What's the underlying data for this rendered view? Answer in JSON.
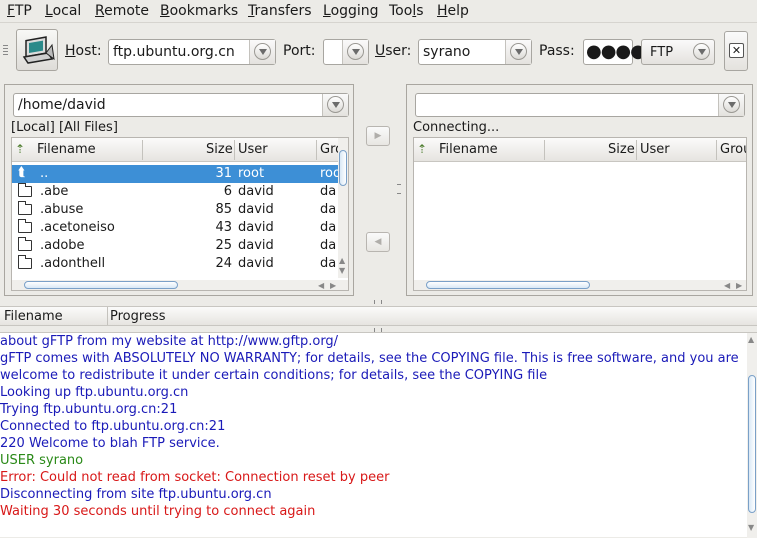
{
  "menu": [
    {
      "pre": "",
      "u": "F",
      "post": "TP"
    },
    {
      "pre": "",
      "u": "L",
      "post": "ocal"
    },
    {
      "pre": "",
      "u": "R",
      "post": "emote"
    },
    {
      "pre": "",
      "u": "B",
      "post": "ookmarks"
    },
    {
      "pre": "",
      "u": "T",
      "post": "ransfers"
    },
    {
      "pre": "",
      "u": "L",
      "post": "ogging"
    },
    {
      "pre": "Too",
      "u": "l",
      "post": "s"
    },
    {
      "pre": "",
      "u": "H",
      "post": "elp"
    }
  ],
  "toolbar": {
    "host_label": "Host:",
    "host_value": "ftp.ubuntu.org.cn",
    "port_label": "Port:",
    "port_value": "",
    "user_label": "User:",
    "user_value": "syrano",
    "pass_label": "Pass:",
    "pass_value": "●●●●",
    "protocol": "FTP"
  },
  "local": {
    "path": "/home/david",
    "status": "[Local] [All Files]",
    "columns": [
      "Filename",
      "Size",
      "User",
      "Gro"
    ],
    "rows": [
      {
        "name": "..",
        "size": "31",
        "user": "root",
        "group": "roo"
      },
      {
        "name": ".abe",
        "size": "6",
        "user": "david",
        "group": "da"
      },
      {
        "name": ".abuse",
        "size": "85",
        "user": "david",
        "group": "da"
      },
      {
        "name": ".acetoneiso",
        "size": "43",
        "user": "david",
        "group": "da"
      },
      {
        "name": ".adobe",
        "size": "25",
        "user": "david",
        "group": "da"
      },
      {
        "name": ".adonthell",
        "size": "24",
        "user": "david",
        "group": "da"
      }
    ]
  },
  "remote": {
    "path": "",
    "status": "Connecting...",
    "columns": [
      "Filename",
      "Size",
      "User",
      "Grou"
    ]
  },
  "queue": {
    "columns": [
      "Filename",
      "Progress"
    ]
  },
  "log": [
    {
      "text": "about gFTP from my website at http://www.gftp.org/",
      "color": "blue"
    },
    {
      "text": "gFTP comes with ABSOLUTELY NO WARRANTY; for details, see the COPYING file. This is free software, and you are",
      "color": "blue"
    },
    {
      "text": "welcome to redistribute it under certain conditions; for details, see the COPYING file",
      "color": "blue"
    },
    {
      "text": "Looking up ftp.ubuntu.org.cn",
      "color": "blue"
    },
    {
      "text": "Trying ftp.ubuntu.org.cn:21",
      "color": "blue"
    },
    {
      "text": "Connected to ftp.ubuntu.org.cn:21",
      "color": "blue"
    },
    {
      "text": "220 Welcome to blah FTP service.",
      "color": "blue"
    },
    {
      "text": "USER syrano",
      "color": "green"
    },
    {
      "text": "Error: Could not read from socket: Connection reset by peer",
      "color": "red"
    },
    {
      "text": "Disconnecting from site ftp.ubuntu.org.cn",
      "color": "blue"
    },
    {
      "text": "Waiting 30 seconds until trying to connect again",
      "color": "red"
    }
  ],
  "colors": {
    "selection": "#3d8fd6",
    "log_blue": "#1a1ab8",
    "log_green": "#2a8a18",
    "log_red": "#d81818"
  }
}
